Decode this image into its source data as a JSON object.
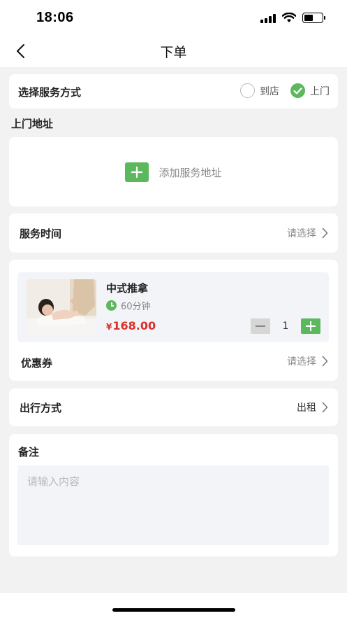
{
  "status": {
    "time": "18:06"
  },
  "nav": {
    "title": "下单"
  },
  "service_mode": {
    "label": "选择服务方式",
    "options": [
      {
        "label": "到店",
        "selected": false
      },
      {
        "label": "上门",
        "selected": true
      }
    ]
  },
  "address": {
    "section_title": "上门地址",
    "add_label": "添加服务地址"
  },
  "service_time": {
    "label": "服务时间",
    "value": "请选择"
  },
  "product": {
    "name": "中式推拿",
    "duration": "60分钟",
    "price_symbol": "¥",
    "price": "168.00",
    "quantity": "1"
  },
  "coupon": {
    "label": "优惠券",
    "value": "请选择"
  },
  "travel": {
    "label": "出行方式",
    "value": "出租"
  },
  "remark": {
    "label": "备注",
    "placeholder": "请输入内容"
  },
  "colors": {
    "accent": "#5cb85c",
    "price": "#d9302b",
    "background": "#f2f2f2"
  },
  "icons": [
    "back-icon",
    "signal-icon",
    "wifi-icon",
    "battery-icon",
    "check-icon",
    "plus-icon",
    "chevron-right-icon",
    "clock-icon",
    "minus-icon"
  ]
}
